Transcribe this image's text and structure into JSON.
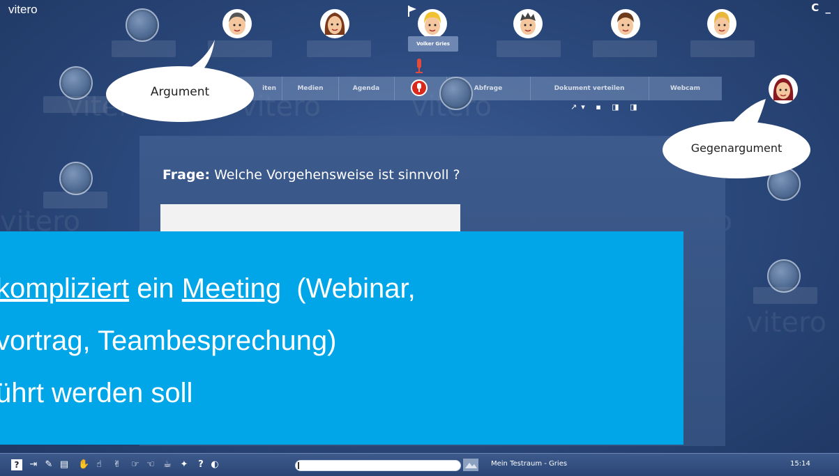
{
  "app": {
    "brand": "vitero",
    "top_right_controls": "C _"
  },
  "watermark": "vitero",
  "participants": {
    "speaker_name": "Volker Gries"
  },
  "tabs": [
    "Bearbeiten",
    "Medien",
    "Agenda",
    "",
    "Abfrage",
    "Dokument verteilen",
    "Webcam"
  ],
  "tab_visible_fragment": "iten",
  "doc_tool_icons": "↗▾ ▪ ◨ ◨",
  "question": {
    "label": "Frage:",
    "text": "Welche Vorgehensweise ist sinnvoll ?"
  },
  "bubbles": {
    "left": "Argument",
    "right": "Gegenargument"
  },
  "overlay": {
    "line1_pre": "kompliziert",
    "line1_mid": " ein ",
    "line1_link": "Meeting",
    "line1_post": "  (Webinar,",
    "line2": "vortrag, Teambesprechung)",
    "line3": "ührt werden soll"
  },
  "bottom_bar": {
    "icons": [
      "help-icon",
      "enter-icon",
      "pointer-icon",
      "notepad-icon",
      "hand-wave-icon",
      "hand-raise-icon",
      "applause-icon",
      "thumb-right-icon",
      "thumb-left-icon",
      "coffee-icon",
      "idea-icon",
      "question-icon",
      "speaker-icon"
    ],
    "room_name": "Mein Testraum - Gries",
    "time": "15:14"
  }
}
